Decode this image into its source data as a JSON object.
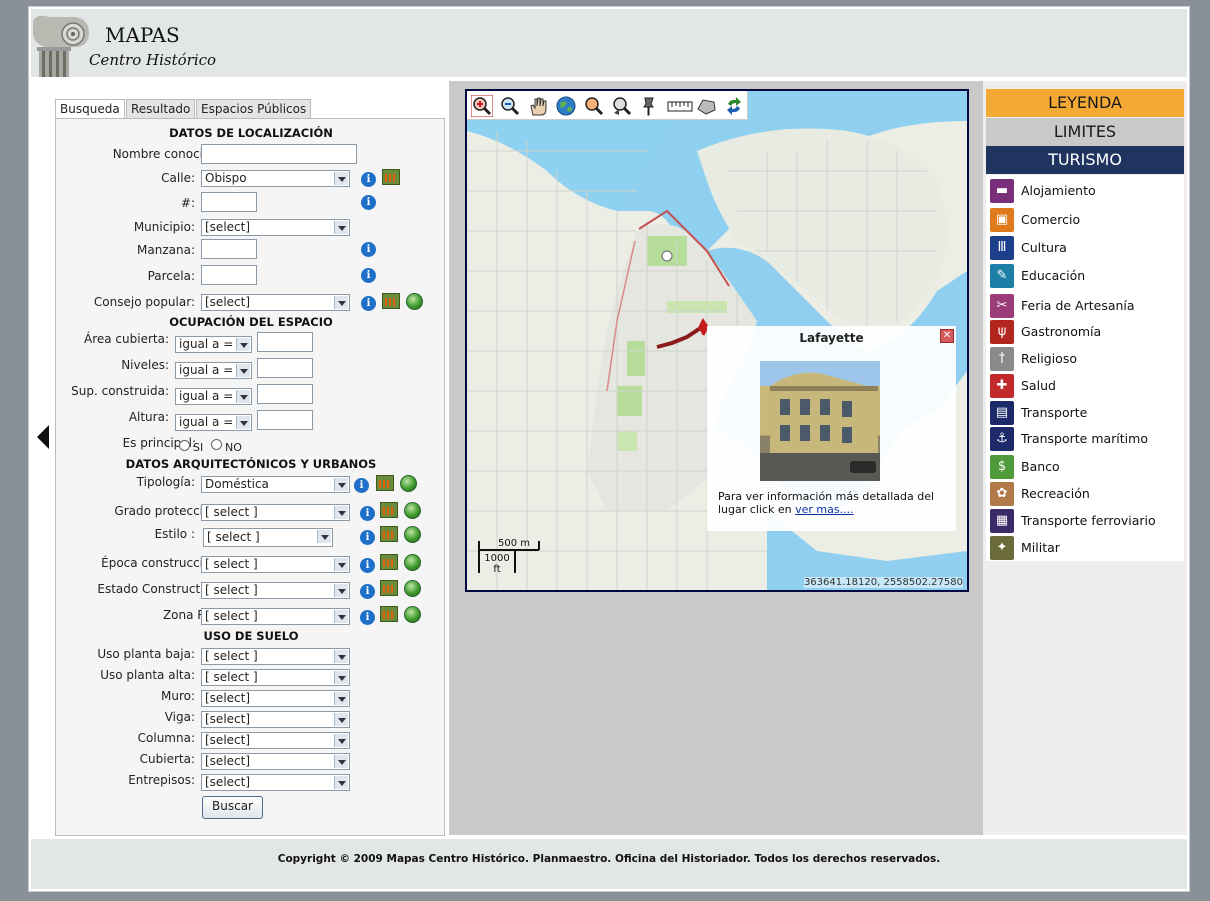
{
  "header": {
    "title": "MAPAS",
    "subtitle": "Centro Histórico"
  },
  "tabs": [
    {
      "label": "Busqueda",
      "active": true
    },
    {
      "label": "Resultado",
      "active": false
    },
    {
      "label": "Espacios Públicos",
      "active": false
    }
  ],
  "sections": {
    "localizacion": "DATOS DE LOCALIZACIÓN",
    "ocupacion": "OCUPACIÓN DEL ESPACIO",
    "arquitectonicos": "DATOS ARQUITECTÓNICOS Y URBANOS",
    "uso_suelo": "USO DE SUELO"
  },
  "form": {
    "nombre_conocido": {
      "label": "Nombre conocido:",
      "value": ""
    },
    "calle": {
      "label": "Calle:",
      "value": "Obispo"
    },
    "numero": {
      "label": "#:",
      "value": ""
    },
    "municipio": {
      "label": "Municipio:",
      "value": "[select]"
    },
    "manzana": {
      "label": "Manzana:",
      "value": ""
    },
    "parcela": {
      "label": "Parcela:",
      "value": ""
    },
    "consejo_popular": {
      "label": "Consejo popular:",
      "value": "[select]"
    },
    "area_cubierta": {
      "label": "Área cubierta:",
      "op": "igual a =",
      "value": ""
    },
    "niveles": {
      "label": "Niveles:",
      "op": "igual a =",
      "value": ""
    },
    "sup_construida": {
      "label": "Sup. construida:",
      "op": "igual a =",
      "value": ""
    },
    "altura": {
      "label": "Altura:",
      "op": "igual a =",
      "value": ""
    },
    "es_principal": {
      "label": "Es principal:",
      "si": "SI",
      "no": "NO"
    },
    "tipologia": {
      "label": "Tipología:",
      "value": "Doméstica"
    },
    "grado_proteccion": {
      "label": "Grado protección:",
      "value": "[ select ]"
    },
    "estilo": {
      "label": "Estilo :",
      "value": "[ select ]"
    },
    "epoca": {
      "label": "Época construcción:",
      "value": "[ select ]"
    },
    "estado": {
      "label": "Estado Constructivo:",
      "value": "[ select ]"
    },
    "zona_riu": {
      "label": "Zona RIU:",
      "value": "[ select ]"
    },
    "uso_baja": {
      "label": "Uso planta baja:",
      "value": "[ select ]"
    },
    "uso_alta": {
      "label": "Uso planta alta:",
      "value": "[ select ]"
    },
    "muro": {
      "label": "Muro:",
      "value": "[select]"
    },
    "viga": {
      "label": "Viga:",
      "value": "[select]"
    },
    "columna": {
      "label": "Columna:",
      "value": "[select]"
    },
    "cubierta": {
      "label": "Cubierta:",
      "value": "[select]"
    },
    "entrepisos": {
      "label": "Entrepisos:",
      "value": "[select]"
    },
    "buscar": "Buscar"
  },
  "map": {
    "popup_title": "Lafayette",
    "popup_text": "Para ver información más detallada del lugar click en ",
    "popup_link": "ver mas....",
    "scale_m": "500 m",
    "scale_ft": "1000",
    "scale_ft_unit": "ft",
    "coords": "363641.18120, 2558502.27580"
  },
  "legend": {
    "leyenda": "LEYENDA",
    "limites": "LIMITES",
    "turismo": "TURISMO",
    "items": [
      {
        "label": "Alojamiento",
        "color": "#7a2f7a",
        "icon": "bed-icon"
      },
      {
        "label": "Comercio",
        "color": "#e07b1d",
        "icon": "shop-icon"
      },
      {
        "label": "Cultura",
        "color": "#1d3e8a",
        "icon": "museum-icon"
      },
      {
        "label": "Educación",
        "color": "#1b7fa8",
        "icon": "education-icon"
      },
      {
        "label": "Feria de Artesanía",
        "color": "#9b3b7a",
        "icon": "craft-icon"
      },
      {
        "label": "Gastronomía",
        "color": "#b3261e",
        "icon": "fork-knife-icon"
      },
      {
        "label": "Religioso",
        "color": "#8a8a8a",
        "icon": "cross-icon"
      },
      {
        "label": "Salud",
        "color": "#c22a2a",
        "icon": "health-icon"
      },
      {
        "label": "Transporte",
        "color": "#1d2a6a",
        "icon": "bus-icon"
      },
      {
        "label": "Transporte marítimo",
        "color": "#1d2a6a",
        "icon": "ship-icon"
      },
      {
        "label": "Banco",
        "color": "#4f9a3a",
        "icon": "bank-icon"
      },
      {
        "label": "Recreación",
        "color": "#b07a48",
        "icon": "recreation-icon"
      },
      {
        "label": "Transporte ferroviario",
        "color": "#3a2a6a",
        "icon": "train-icon"
      },
      {
        "label": "Militar",
        "color": "#6a6a3a",
        "icon": "military-icon"
      }
    ]
  },
  "footer": {
    "text": "Copyright © 2009 Mapas Centro Histórico. Planmaestro. Oficina del Historiador. Todos los derechos reservados."
  }
}
